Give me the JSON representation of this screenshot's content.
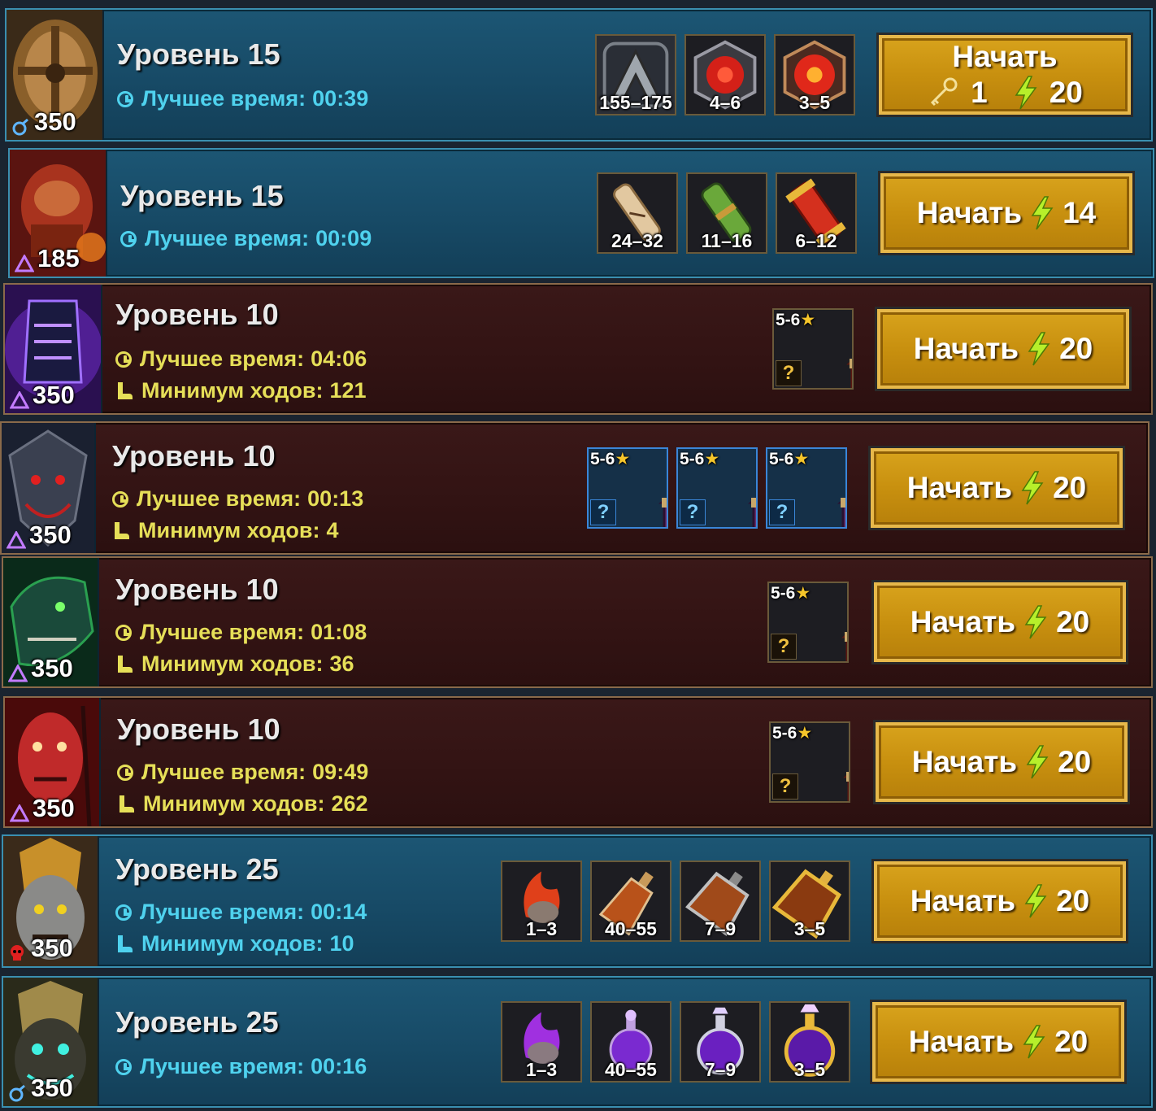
{
  "labels": {
    "best_time_prefix": "Лучшее время:",
    "min_moves_prefix": "Минимум ходов:",
    "start": "Начать"
  },
  "rows": [
    {
      "theme": "blue",
      "title": "Уровень 15",
      "power": "350",
      "power_icon": "water-affinity-icon",
      "best_time": "00:39",
      "min_moves": null,
      "rewards": [
        "155–175",
        "4–6",
        "3–5"
      ],
      "start_key": "1",
      "start_energy": "20"
    },
    {
      "theme": "blue",
      "title": "Уровень 15",
      "power": "185",
      "power_icon": "triangle-icon",
      "best_time": "00:09",
      "min_moves": null,
      "rewards": [
        "24–32",
        "11–16",
        "6–12"
      ],
      "start_energy": "14"
    },
    {
      "theme": "brown",
      "title": "Уровень 10",
      "power": "350",
      "power_icon": "triangle-icon",
      "best_time": "04:06",
      "min_moves": "121",
      "rewards_stars": "5-6",
      "start_energy": "20"
    },
    {
      "theme": "brown",
      "title": "Уровень 10",
      "power": "350",
      "power_icon": "triangle-icon",
      "best_time": "00:13",
      "min_moves": "4",
      "rewards_stars": "5-6",
      "start_energy": "20"
    },
    {
      "theme": "brown",
      "title": "Уровень 10",
      "power": "350",
      "power_icon": "triangle-icon",
      "best_time": "01:08",
      "min_moves": "36",
      "rewards_stars": "5-6",
      "start_energy": "20"
    },
    {
      "theme": "brown",
      "title": "Уровень 10",
      "power": "350",
      "power_icon": "triangle-icon",
      "best_time": "09:49",
      "min_moves": "262",
      "rewards_stars": "5-6",
      "start_energy": "20"
    },
    {
      "theme": "blue",
      "title": "Уровень 25",
      "power": "350",
      "power_icon": "skull-icon",
      "best_time": "00:14",
      "min_moves": "10",
      "rewards": [
        "1–3",
        "40–55",
        "7–9",
        "3–5"
      ],
      "start_energy": "20"
    },
    {
      "theme": "blue",
      "title": "Уровень 25",
      "power": "350",
      "power_icon": "water-affinity-icon",
      "best_time": "00:16",
      "min_moves": null,
      "rewards": [
        "1–3",
        "40–55",
        "7–9",
        "3–5"
      ],
      "start_energy": "20"
    }
  ],
  "colors": {
    "blue_stat": "#4fd2ee",
    "brown_stat": "#e6df58",
    "button_gold": "#c8900f",
    "energy_bolt": "#a6e01a"
  }
}
